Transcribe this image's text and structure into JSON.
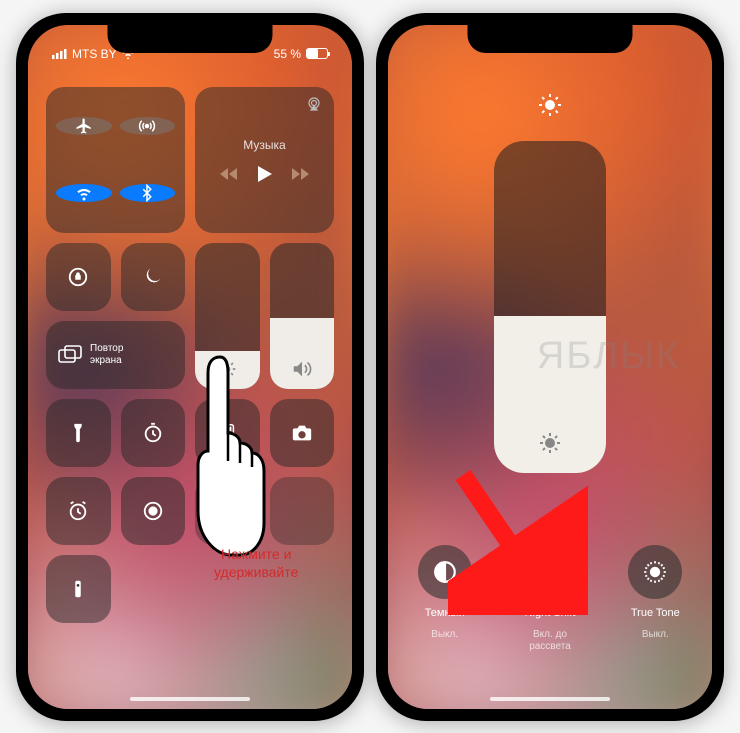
{
  "watermark": "ЯБЛЫК",
  "left": {
    "status": {
      "carrier": "MTS BY",
      "battery_pct": "55 %"
    },
    "music": {
      "label": "Музыка",
      "airplay": "airplay-icon"
    },
    "mirror": {
      "label": "Повтор\nэкрана"
    },
    "annotation": "Нажмите и\nудерживайте",
    "connectivity": {
      "airplane": false,
      "cellular": true,
      "wifi": true,
      "bluetooth": true
    },
    "sliders": {
      "brightness_pct": 26,
      "volume_pct": 48
    },
    "bottom_icons": [
      "flashlight",
      "timer",
      "calculator",
      "camera",
      "alarm",
      "screen-record",
      "",
      "",
      "remote"
    ]
  },
  "right": {
    "slider": {
      "brightness_pct": 47
    },
    "modes": [
      {
        "title": "Темный",
        "sub": "Выкл.",
        "icon": "dark-mode-icon",
        "active": false
      },
      {
        "title": "Night Shift",
        "sub": "Вкл. до\nрассвета",
        "icon": "night-shift-icon",
        "active": true
      },
      {
        "title": "True Tone",
        "sub": "Выкл.",
        "icon": "true-tone-icon",
        "active": false
      }
    ]
  }
}
